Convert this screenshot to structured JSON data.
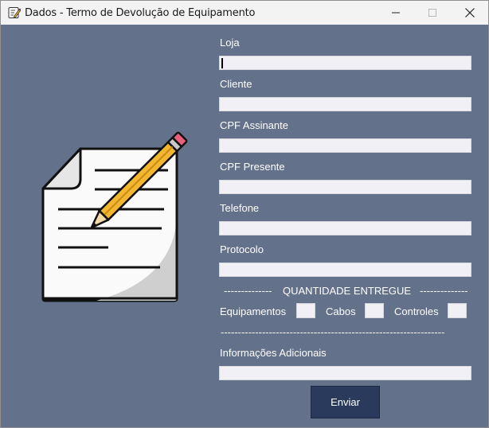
{
  "window": {
    "title": "Dados - Termo de Devolução de Equipamento",
    "controls": {
      "minimize": "minimize",
      "maximize": "maximize",
      "close": "close"
    }
  },
  "form": {
    "fields": [
      {
        "label": "Loja",
        "value": ""
      },
      {
        "label": "Cliente",
        "value": ""
      },
      {
        "label": "CPF Assinante",
        "value": ""
      },
      {
        "label": "CPF Presente",
        "value": ""
      },
      {
        "label": "Telefone",
        "value": ""
      },
      {
        "label": "Protocolo",
        "value": ""
      }
    ],
    "quantity_section": {
      "dashes_left": "--------------",
      "title": "QUANTIDADE ENTREGUE",
      "dashes_right": "--------------",
      "items": [
        {
          "label": "Equipamentos",
          "value": ""
        },
        {
          "label": "Cabos",
          "value": ""
        },
        {
          "label": "Controles",
          "value": ""
        }
      ],
      "divider": "-----------------------------------------------------------------"
    },
    "additional_info": {
      "label": "Informações Adicionais",
      "value": ""
    },
    "submit_label": "Enviar"
  },
  "icons": {
    "app": "notepad-pencil-icon",
    "illustration": "document-pencil-icon"
  },
  "colors": {
    "background": "#64718a",
    "button": "#2a3a5c",
    "pencil_body": "#f2b630",
    "eraser": "#e8607e"
  }
}
